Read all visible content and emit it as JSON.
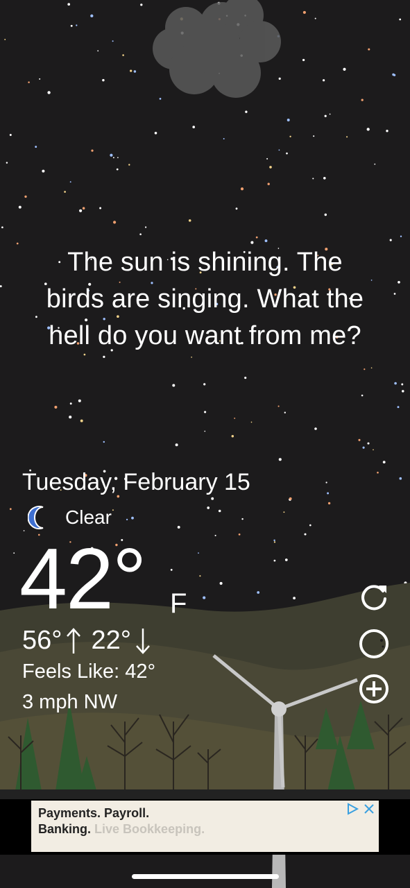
{
  "quote": {
    "line1": "The sun is shining. The",
    "line2": "birds are singing. What the",
    "line3": "hell do you want from me?"
  },
  "weather": {
    "date": "Tuesday, February 15",
    "condition": "Clear",
    "condition_icon": "moon-icon",
    "temperature": "42°",
    "unit": "F",
    "high": "56°",
    "low": "22°",
    "feels_like": "Feels Like: 42°",
    "wind": "3 mph NW"
  },
  "actions": {
    "refresh_icon": "refresh-icon",
    "theme_icon": "moon-phase-icon",
    "add_icon": "add-circle-icon"
  },
  "ad": {
    "line1": "Payments. Payroll.",
    "line2_bold": "Banking.",
    "line2_faded": "Live Bookkeeping.",
    "choices_icon": "adchoices-icon",
    "close_icon": "close-icon"
  },
  "colors": {
    "sky": "#1c1b1c",
    "hills": "#4e4c3a",
    "moon": "#3f6fd0",
    "ad_background": "#f2ede3",
    "adchoice": "#3aa0e0"
  }
}
